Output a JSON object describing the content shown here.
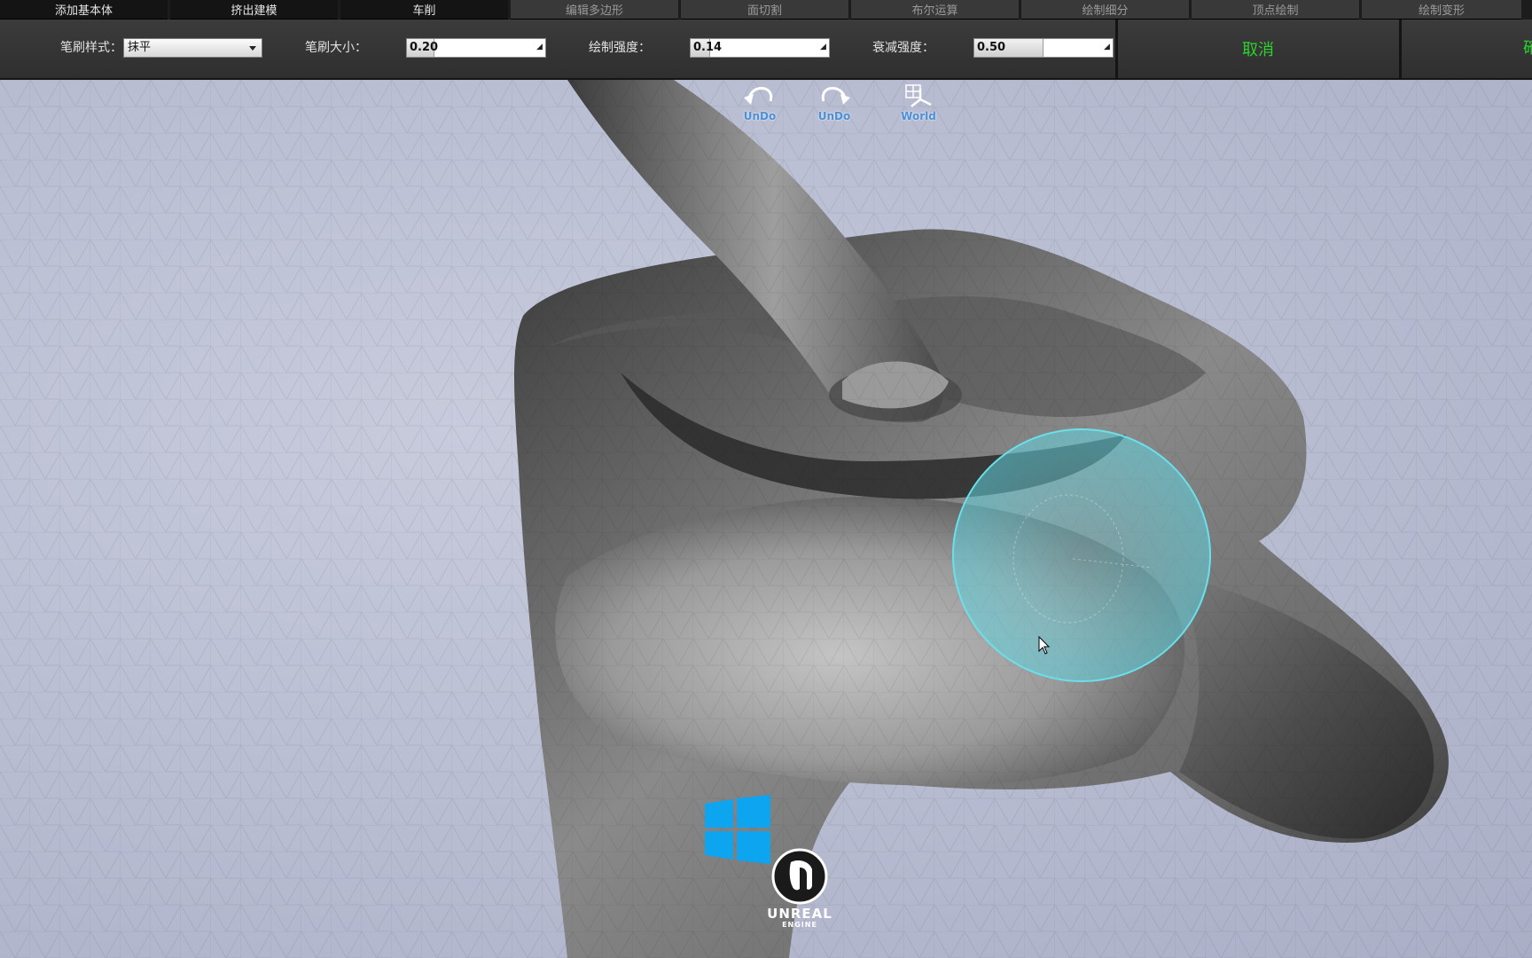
{
  "tabs": [
    {
      "label": "添加基本体",
      "active": true
    },
    {
      "label": "挤出建模",
      "active": true
    },
    {
      "label": "车削",
      "active": true
    },
    {
      "label": "编辑多边形",
      "active": false
    },
    {
      "label": "面切割",
      "active": false
    },
    {
      "label": "布尔运算",
      "active": false
    },
    {
      "label": "绘制细分",
      "active": false
    },
    {
      "label": "顶点绘制",
      "active": false
    },
    {
      "label": "绘制变形",
      "active": false
    }
  ],
  "toolbar": {
    "brush_style_label": "笔刷样式：",
    "brush_style_value": "抹平",
    "brush_size_label": "笔刷大小：",
    "brush_size_value": "0.20",
    "brush_size_fraction": 0.2,
    "strength_label": "绘制强度：",
    "strength_value": "0.14",
    "strength_fraction": 0.14,
    "falloff_label": "衰减强度：",
    "falloff_value": "0.50",
    "falloff_fraction": 0.5,
    "cancel_label": "取消",
    "confirm_label_partial": "確"
  },
  "viewport": {
    "undo_label": "UnDo",
    "redo_label": "UnDo",
    "world_label": "World",
    "engine_logo_line1": "UNREAL",
    "engine_logo_line2": "ENGINE"
  },
  "colors": {
    "accent_green": "#2ed12e",
    "icon_blue": "#4b8fd6",
    "brush_cyan": "#5fd3df",
    "windows_blue": "#0ea5f0"
  }
}
